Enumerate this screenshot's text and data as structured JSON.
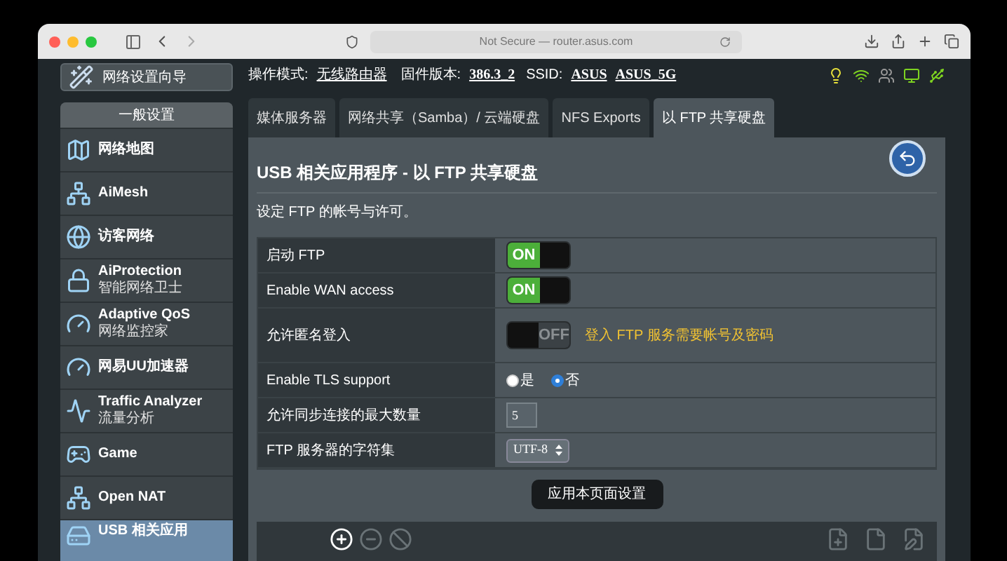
{
  "browser": {
    "address": "Not Secure — router.asus.com"
  },
  "sidebar": {
    "wizard": "网络设置向导",
    "section": "一般设置",
    "items": [
      {
        "label": "网络地图",
        "selected": false
      },
      {
        "label": "AiMesh",
        "selected": false
      },
      {
        "label": "访客网络",
        "selected": false
      },
      {
        "label": "AiProtection",
        "sublabel": "智能网络卫士",
        "selected": false
      },
      {
        "label": "Adaptive QoS",
        "sublabel": "网络监控家",
        "selected": false
      },
      {
        "label": "网易UU加速器",
        "selected": false
      },
      {
        "label": "Traffic Analyzer",
        "sublabel": "流量分析",
        "selected": false
      },
      {
        "label": "Game",
        "selected": false
      },
      {
        "label": "Open NAT",
        "selected": false
      },
      {
        "label": "USB 相关应用",
        "selected": true
      }
    ]
  },
  "status": {
    "mode_label": "操作模式:",
    "mode": "无线路由器",
    "firmware_label": "固件版本:",
    "firmware": "386.3_2",
    "ssid_label": "SSID:",
    "ssids": [
      "ASUS",
      "ASUS_5G"
    ]
  },
  "tabs": [
    {
      "label": "媒体服务器",
      "selected": false
    },
    {
      "label": "网络共享（Samba）/ 云端硬盘",
      "selected": false
    },
    {
      "label": "NFS Exports",
      "selected": false
    },
    {
      "label": "以 FTP 共享硬盘",
      "selected": true
    }
  ],
  "panel": {
    "title": "USB 相关应用程序 - 以 FTP 共享硬盘",
    "description": "设定 FTP 的帐号与许可。",
    "rows": [
      {
        "kind": "toggle",
        "label": "启动 FTP",
        "on": true,
        "text": "ON"
      },
      {
        "kind": "toggle",
        "label": "Enable WAN access",
        "on": true,
        "text": "ON"
      },
      {
        "kind": "toggle",
        "label": "允许匿名登入",
        "on": false,
        "text": "OFF",
        "note": "登入 FTP 服务需要帐号及密码"
      },
      {
        "kind": "radio",
        "label": "Enable TLS support",
        "options": [
          {
            "label": "是",
            "selected": false
          },
          {
            "label": "否",
            "selected": true
          }
        ]
      },
      {
        "kind": "input",
        "label": "允许同步连接的最大数量",
        "value": "5"
      },
      {
        "kind": "select",
        "label": "FTP 服务器的字符集",
        "value": "UTF-8"
      }
    ],
    "apply": "应用本页面设置"
  }
}
